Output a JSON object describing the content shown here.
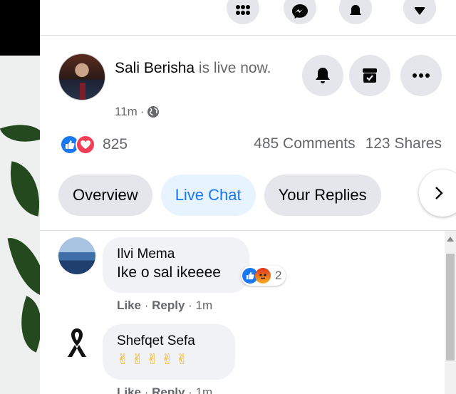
{
  "topbar": {
    "buttons": [
      {
        "icon": "menu-grid-icon"
      },
      {
        "icon": "messenger-icon"
      },
      {
        "icon": "notifications-bell-icon"
      },
      {
        "icon": "account-caret-icon"
      }
    ]
  },
  "post": {
    "author": "Sali Berisha",
    "status_text": "is live now.",
    "time": "11m",
    "privacy_icon": "globe-icon",
    "reaction_count": "825",
    "comments": "485 Comments",
    "shares": "123 Shares"
  },
  "tabs": [
    {
      "label": "Overview",
      "active": false
    },
    {
      "label": "Live Chat",
      "active": true
    },
    {
      "label": "Your Replies",
      "active": false
    }
  ],
  "comments": [
    {
      "name": "Ilvi Mema",
      "text": "Ike o sal ikeeee",
      "reaction_count": "2",
      "like": "Like",
      "reply": "Reply",
      "time": "1m"
    },
    {
      "name": "Shefqet Sefa",
      "text": "✌✌✌✌✌",
      "like": "Like",
      "reply": "Reply",
      "time": "1m"
    }
  ],
  "colors": {
    "accent": "#1877f2",
    "button_bg": "#e4e6eb",
    "secondary_text": "#65676b",
    "bubble_bg": "#f0f2f5"
  }
}
